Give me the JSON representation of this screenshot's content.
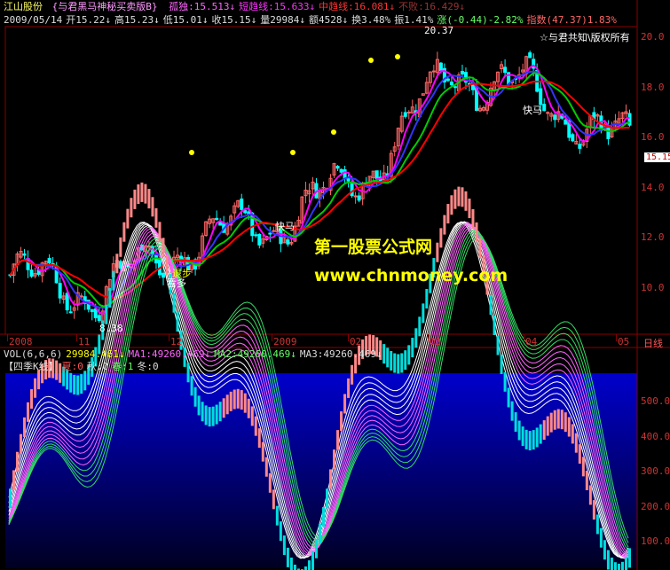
{
  "header": {
    "stock_name": "江山股份",
    "formula_name": "{与君黑马神秘买卖版B}",
    "line1": [
      {
        "label": "孤独:15.513",
        "arrow": "↓",
        "color": "#ff66ff"
      },
      {
        "label": "短趋线:15.633",
        "arrow": "↓",
        "color": "#ff33ff"
      },
      {
        "label": "中趋线:16.081",
        "arrow": "↓",
        "color": "#ff3333"
      },
      {
        "label": "不败:16.429",
        "arrow": "↓",
        "color": "#993333"
      }
    ],
    "line2": [
      {
        "label": "2009/05/14",
        "color": "#dddddd"
      },
      {
        "label": "开15.22",
        "arrow": "↓",
        "color": "#dddddd"
      },
      {
        "label": "高15.23",
        "arrow": "↓",
        "color": "#dddddd"
      },
      {
        "label": "低15.01",
        "arrow": "↓",
        "color": "#dddddd"
      },
      {
        "label": "收15.15",
        "arrow": "↓",
        "color": "#dddddd"
      },
      {
        "label": "量29984",
        "arrow": "↓",
        "color": "#dddddd"
      },
      {
        "label": "额4528",
        "arrow": "↓",
        "color": "#dddddd"
      },
      {
        "label": "换3.48%",
        "color": "#dddddd"
      },
      {
        "label": "振1.41%",
        "color": "#dddddd"
      },
      {
        "label": "涨(-0.44)-2.82%",
        "color": "#66ff66"
      },
      {
        "label": "指数(47.37)1.83%",
        "color": "#ff6666"
      }
    ]
  },
  "annotations": {
    "copyright": "☆与君共知\\版权所有",
    "high_label": "20.37",
    "low_label": "8.38",
    "kuaima_1": "快马",
    "kuaima_2": "快马",
    "kuaima_3": "快马",
    "buy_label": "看多",
    "sell_label": "退步"
  },
  "watermark": {
    "title": "第一股票公式网",
    "url": "www.chnmoney.com"
  },
  "price_axis": {
    "ticks": [
      "20.0",
      "18.0",
      "16.0",
      "14.0",
      "12.0",
      "10.0"
    ],
    "current_price": "15.15"
  },
  "time_axis": {
    "labels": [
      "2008",
      "11",
      "12",
      "2009",
      "02",
      "03",
      "04",
      "05"
    ],
    "period": "日线"
  },
  "volume_header": [
    {
      "label": "VOL(6,6,6)",
      "color": "#dddddd"
    },
    {
      "label": "29984.461",
      "arrow": "↓",
      "color": "#ffff00"
    },
    {
      "label": "MA1:49260.469",
      "arrow": "↓",
      "color": "#ff66ff"
    },
    {
      "label": "MA2:49260.469",
      "arrow": "↓",
      "color": "#66ff66"
    },
    {
      "label": "MA3:49260.469",
      "arrow": "↓",
      "color": "#dddddd"
    }
  ],
  "season_header": [
    {
      "label": "【四季K线】",
      "color": "#dddddd"
    },
    {
      "label": "夏:0",
      "color": "#ff5555"
    },
    {
      "label": "秋:0",
      "color": "#dddddd"
    },
    {
      "label": "春:1",
      "color": "#66ff66"
    },
    {
      "label": "冬:0",
      "color": "#dddddd"
    }
  ],
  "indicator_axis": {
    "ticks": [
      "500.0",
      "400.0",
      "300.0",
      "200.0",
      "100.0"
    ]
  },
  "colors": {
    "up": "#ff6666",
    "down": "#00ffff",
    "ma_blue": "#3333ff",
    "ma_green": "#00cc00",
    "ma_magenta": "#ff00ff",
    "ma_red": "#ff0000",
    "marker_yellow": "#ffff00",
    "indicator_bg_top": "#0000cc",
    "indicator_bg_bottom": "#000033"
  },
  "chart_data": {
    "type": "line",
    "title": "",
    "xlabel": "",
    "ylabel": "",
    "ylim": [
      8,
      21
    ],
    "x": [
      "2008-10",
      "2008-11",
      "2008-12",
      "2009-01",
      "2009-02",
      "2009-03",
      "2009-04",
      "2009-05"
    ],
    "series": [
      {
        "name": "孤独",
        "values": [
          10.5,
          9.8,
          11.8,
          12.6,
          14.5,
          18.7,
          17.6,
          15.5
        ]
      },
      {
        "name": "中趋线",
        "values": [
          11.0,
          10.1,
          11.3,
          12.3,
          13.7,
          18.0,
          17.9,
          16.1
        ]
      }
    ]
  }
}
